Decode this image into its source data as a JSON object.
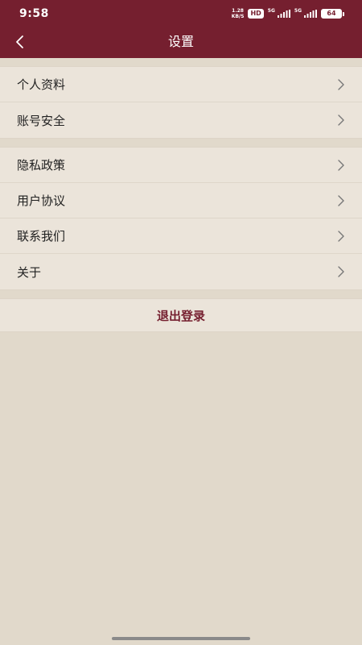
{
  "status_bar": {
    "time": "9:58",
    "net_speed_value": "1.28",
    "net_speed_unit": "KB/S",
    "hd_badge": "HD",
    "sim1_label": "5G",
    "sim2_label": "5G",
    "battery_level": "64"
  },
  "header": {
    "title": "设置",
    "back_icon": "chevron-left-icon"
  },
  "settings": {
    "group1": [
      {
        "label": "个人资料"
      },
      {
        "label": "账号安全"
      }
    ],
    "group2": [
      {
        "label": "隐私政策"
      },
      {
        "label": "用户协议"
      },
      {
        "label": "联系我们"
      },
      {
        "label": "关于"
      }
    ]
  },
  "logout": {
    "label": "退出登录"
  },
  "colors": {
    "brand": "#751f2f",
    "background": "#e1d9cb",
    "row_background": "#ebe4da"
  }
}
